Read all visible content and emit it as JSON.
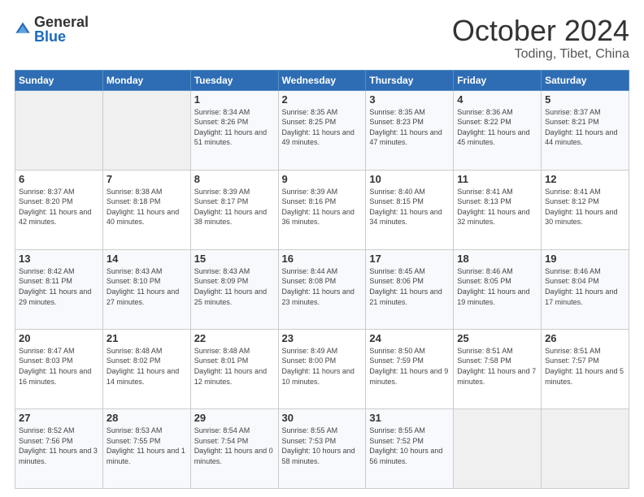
{
  "header": {
    "logo": {
      "general": "General",
      "blue": "Blue"
    },
    "month": "October 2024",
    "location": "Toding, Tibet, China"
  },
  "days_of_week": [
    "Sunday",
    "Monday",
    "Tuesday",
    "Wednesday",
    "Thursday",
    "Friday",
    "Saturday"
  ],
  "weeks": [
    [
      {
        "day": "",
        "sunrise": "",
        "sunset": "",
        "daylight": "",
        "empty": true
      },
      {
        "day": "",
        "sunrise": "",
        "sunset": "",
        "daylight": "",
        "empty": true
      },
      {
        "day": "1",
        "sunrise": "Sunrise: 8:34 AM",
        "sunset": "Sunset: 8:26 PM",
        "daylight": "Daylight: 11 hours and 51 minutes."
      },
      {
        "day": "2",
        "sunrise": "Sunrise: 8:35 AM",
        "sunset": "Sunset: 8:25 PM",
        "daylight": "Daylight: 11 hours and 49 minutes."
      },
      {
        "day": "3",
        "sunrise": "Sunrise: 8:35 AM",
        "sunset": "Sunset: 8:23 PM",
        "daylight": "Daylight: 11 hours and 47 minutes."
      },
      {
        "day": "4",
        "sunrise": "Sunrise: 8:36 AM",
        "sunset": "Sunset: 8:22 PM",
        "daylight": "Daylight: 11 hours and 45 minutes."
      },
      {
        "day": "5",
        "sunrise": "Sunrise: 8:37 AM",
        "sunset": "Sunset: 8:21 PM",
        "daylight": "Daylight: 11 hours and 44 minutes."
      }
    ],
    [
      {
        "day": "6",
        "sunrise": "Sunrise: 8:37 AM",
        "sunset": "Sunset: 8:20 PM",
        "daylight": "Daylight: 11 hours and 42 minutes."
      },
      {
        "day": "7",
        "sunrise": "Sunrise: 8:38 AM",
        "sunset": "Sunset: 8:18 PM",
        "daylight": "Daylight: 11 hours and 40 minutes."
      },
      {
        "day": "8",
        "sunrise": "Sunrise: 8:39 AM",
        "sunset": "Sunset: 8:17 PM",
        "daylight": "Daylight: 11 hours and 38 minutes."
      },
      {
        "day": "9",
        "sunrise": "Sunrise: 8:39 AM",
        "sunset": "Sunset: 8:16 PM",
        "daylight": "Daylight: 11 hours and 36 minutes."
      },
      {
        "day": "10",
        "sunrise": "Sunrise: 8:40 AM",
        "sunset": "Sunset: 8:15 PM",
        "daylight": "Daylight: 11 hours and 34 minutes."
      },
      {
        "day": "11",
        "sunrise": "Sunrise: 8:41 AM",
        "sunset": "Sunset: 8:13 PM",
        "daylight": "Daylight: 11 hours and 32 minutes."
      },
      {
        "day": "12",
        "sunrise": "Sunrise: 8:41 AM",
        "sunset": "Sunset: 8:12 PM",
        "daylight": "Daylight: 11 hours and 30 minutes."
      }
    ],
    [
      {
        "day": "13",
        "sunrise": "Sunrise: 8:42 AM",
        "sunset": "Sunset: 8:11 PM",
        "daylight": "Daylight: 11 hours and 29 minutes."
      },
      {
        "day": "14",
        "sunrise": "Sunrise: 8:43 AM",
        "sunset": "Sunset: 8:10 PM",
        "daylight": "Daylight: 11 hours and 27 minutes."
      },
      {
        "day": "15",
        "sunrise": "Sunrise: 8:43 AM",
        "sunset": "Sunset: 8:09 PM",
        "daylight": "Daylight: 11 hours and 25 minutes."
      },
      {
        "day": "16",
        "sunrise": "Sunrise: 8:44 AM",
        "sunset": "Sunset: 8:08 PM",
        "daylight": "Daylight: 11 hours and 23 minutes."
      },
      {
        "day": "17",
        "sunrise": "Sunrise: 8:45 AM",
        "sunset": "Sunset: 8:06 PM",
        "daylight": "Daylight: 11 hours and 21 minutes."
      },
      {
        "day": "18",
        "sunrise": "Sunrise: 8:46 AM",
        "sunset": "Sunset: 8:05 PM",
        "daylight": "Daylight: 11 hours and 19 minutes."
      },
      {
        "day": "19",
        "sunrise": "Sunrise: 8:46 AM",
        "sunset": "Sunset: 8:04 PM",
        "daylight": "Daylight: 11 hours and 17 minutes."
      }
    ],
    [
      {
        "day": "20",
        "sunrise": "Sunrise: 8:47 AM",
        "sunset": "Sunset: 8:03 PM",
        "daylight": "Daylight: 11 hours and 16 minutes."
      },
      {
        "day": "21",
        "sunrise": "Sunrise: 8:48 AM",
        "sunset": "Sunset: 8:02 PM",
        "daylight": "Daylight: 11 hours and 14 minutes."
      },
      {
        "day": "22",
        "sunrise": "Sunrise: 8:48 AM",
        "sunset": "Sunset: 8:01 PM",
        "daylight": "Daylight: 11 hours and 12 minutes."
      },
      {
        "day": "23",
        "sunrise": "Sunrise: 8:49 AM",
        "sunset": "Sunset: 8:00 PM",
        "daylight": "Daylight: 11 hours and 10 minutes."
      },
      {
        "day": "24",
        "sunrise": "Sunrise: 8:50 AM",
        "sunset": "Sunset: 7:59 PM",
        "daylight": "Daylight: 11 hours and 9 minutes."
      },
      {
        "day": "25",
        "sunrise": "Sunrise: 8:51 AM",
        "sunset": "Sunset: 7:58 PM",
        "daylight": "Daylight: 11 hours and 7 minutes."
      },
      {
        "day": "26",
        "sunrise": "Sunrise: 8:51 AM",
        "sunset": "Sunset: 7:57 PM",
        "daylight": "Daylight: 11 hours and 5 minutes."
      }
    ],
    [
      {
        "day": "27",
        "sunrise": "Sunrise: 8:52 AM",
        "sunset": "Sunset: 7:56 PM",
        "daylight": "Daylight: 11 hours and 3 minutes."
      },
      {
        "day": "28",
        "sunrise": "Sunrise: 8:53 AM",
        "sunset": "Sunset: 7:55 PM",
        "daylight": "Daylight: 11 hours and 1 minute."
      },
      {
        "day": "29",
        "sunrise": "Sunrise: 8:54 AM",
        "sunset": "Sunset: 7:54 PM",
        "daylight": "Daylight: 11 hours and 0 minutes."
      },
      {
        "day": "30",
        "sunrise": "Sunrise: 8:55 AM",
        "sunset": "Sunset: 7:53 PM",
        "daylight": "Daylight: 10 hours and 58 minutes."
      },
      {
        "day": "31",
        "sunrise": "Sunrise: 8:55 AM",
        "sunset": "Sunset: 7:52 PM",
        "daylight": "Daylight: 10 hours and 56 minutes."
      },
      {
        "day": "",
        "sunrise": "",
        "sunset": "",
        "daylight": "",
        "empty": true
      },
      {
        "day": "",
        "sunrise": "",
        "sunset": "",
        "daylight": "",
        "empty": true
      }
    ]
  ]
}
